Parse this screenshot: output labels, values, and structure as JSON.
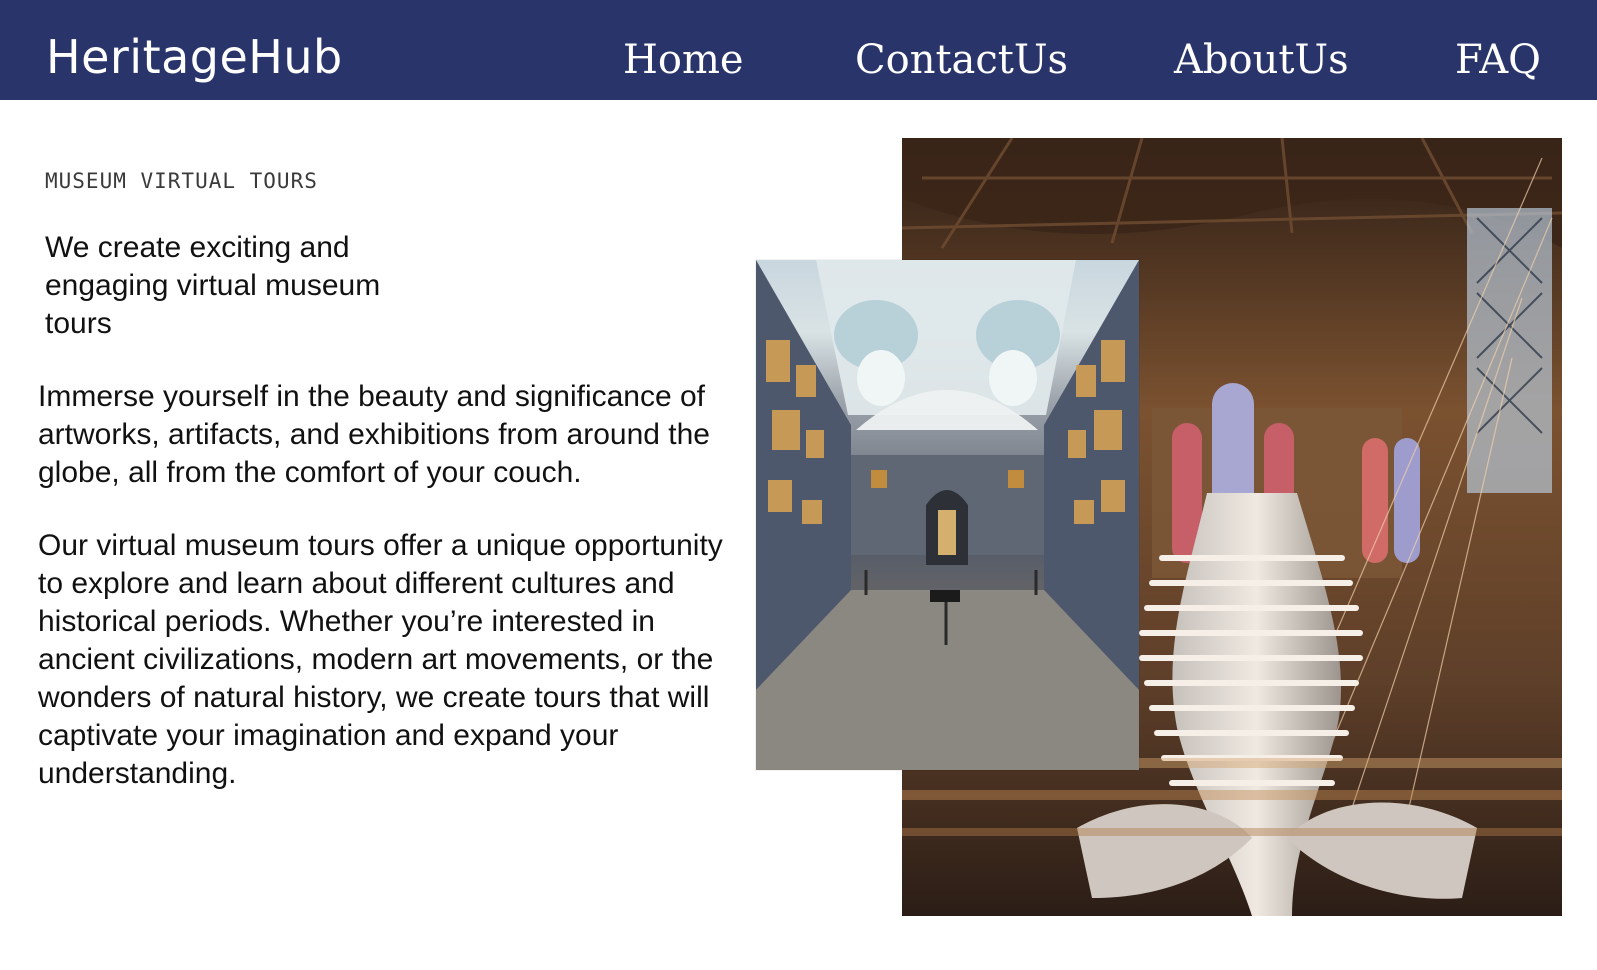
{
  "header": {
    "brand": "HeritageHub",
    "nav": [
      {
        "label": "Home"
      },
      {
        "label": "ContactUs"
      },
      {
        "label": "AboutUs"
      },
      {
        "label": "FAQ"
      }
    ]
  },
  "hero": {
    "eyebrow": "MUSEUM VIRTUAL TOURS",
    "headline": "We create exciting and engaging virtual museum tours",
    "paragraph_1": "Immerse yourself in the beauty and significance of artworks, artifacts,  and exhibitions from around the globe, all from the comfort of your  couch.",
    "paragraph_2": "Our virtual museum tours offer a unique opportunity to explore and learn about different cultures and historical periods. Whether you’re interested in ancient civilizations, modern art movements, or the  wonders of natural history, we create tours that will captivate your  imagination and expand your understanding."
  },
  "images": [
    {
      "subject": "natural-history-hall-with-whale-skeleton"
    },
    {
      "subject": "art-gallery-interior"
    }
  ],
  "colors": {
    "header_bg": "#29356a",
    "header_text": "#ffffff",
    "body_text": "#111111"
  }
}
